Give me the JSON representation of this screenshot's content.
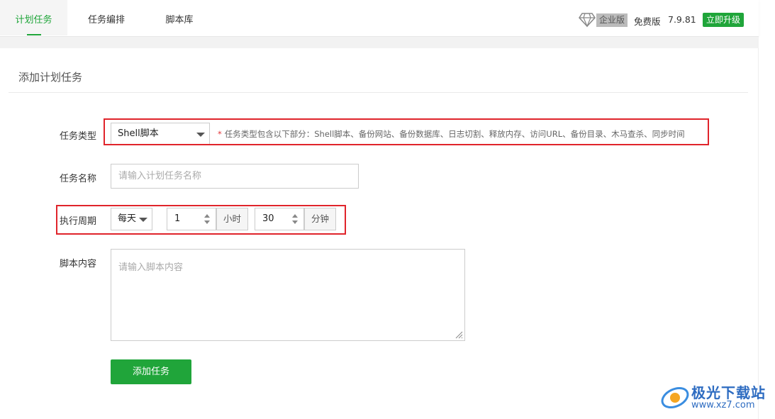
{
  "tabs": [
    {
      "label": "计划任务",
      "active": true
    },
    {
      "label": "任务编排",
      "active": false
    },
    {
      "label": "脚本库",
      "active": false
    }
  ],
  "header": {
    "enterprise_label": "企业版",
    "free_label": "免费版",
    "version": "7.9.81",
    "upgrade_label": "立即升级",
    "icons": {
      "enterprise": "diamond-icon"
    }
  },
  "form": {
    "title": "添加计划任务",
    "task_type": {
      "label": "任务类型",
      "selected": "Shell脚本",
      "hint_star": "*",
      "hint": "任务类型包含以下部分：Shell脚本、备份网站、备份数据库、日志切割、释放内存、访问URL、备份目录、木马查杀、同步时间"
    },
    "task_name": {
      "label": "任务名称",
      "value": "",
      "placeholder": "请输入计划任务名称"
    },
    "period": {
      "label": "执行周期",
      "selected": "每天",
      "hour_value": "1",
      "hour_unit": "小时",
      "minute_value": "30",
      "minute_unit": "分钟"
    },
    "script": {
      "label": "脚本内容",
      "value": "",
      "placeholder": "请输入脚本内容"
    },
    "submit_label": "添加任务"
  },
  "watermark": {
    "text": "极光下载站",
    "url": "www.xz7.com"
  },
  "colors": {
    "accent": "#20a53a",
    "highlight": "#e0242b"
  }
}
